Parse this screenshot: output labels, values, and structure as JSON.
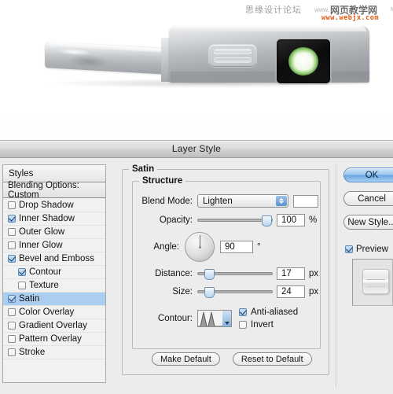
{
  "watermark": {
    "forum_cn": "思缘设计论坛",
    "www_prefix": "www.",
    "site_cn": "网页教学网",
    "tm": "M",
    "url": "www.webjx.com"
  },
  "photo": {
    "alt_name": "metallic-handheld-device-with-green-screen"
  },
  "dialog": {
    "title": "Layer Style",
    "styles_panel": {
      "header": "Styles",
      "blending_options": "Blending Options: Custom",
      "items": [
        {
          "label": "Drop Shadow",
          "checked": false,
          "indent": false,
          "selected": false
        },
        {
          "label": "Inner Shadow",
          "checked": true,
          "indent": false,
          "selected": false
        },
        {
          "label": "Outer Glow",
          "checked": false,
          "indent": false,
          "selected": false
        },
        {
          "label": "Inner Glow",
          "checked": false,
          "indent": false,
          "selected": false
        },
        {
          "label": "Bevel and Emboss",
          "checked": true,
          "indent": false,
          "selected": false
        },
        {
          "label": "Contour",
          "checked": true,
          "indent": true,
          "selected": false
        },
        {
          "label": "Texture",
          "checked": false,
          "indent": true,
          "selected": false
        },
        {
          "label": "Satin",
          "checked": true,
          "indent": false,
          "selected": true
        },
        {
          "label": "Color Overlay",
          "checked": false,
          "indent": false,
          "selected": false
        },
        {
          "label": "Gradient Overlay",
          "checked": false,
          "indent": false,
          "selected": false
        },
        {
          "label": "Pattern Overlay",
          "checked": false,
          "indent": false,
          "selected": false
        },
        {
          "label": "Stroke",
          "checked": false,
          "indent": false,
          "selected": false
        }
      ]
    },
    "satin": {
      "group_legend": "Satin",
      "structure_legend": "Structure",
      "blend_mode": {
        "label": "Blend Mode:",
        "value": "Lighten",
        "swatch_color": "#ffffff"
      },
      "opacity": {
        "label": "Opacity:",
        "value": "100",
        "unit": "%",
        "slider_pct": 96
      },
      "angle": {
        "label": "Angle:",
        "value": "90",
        "unit": "°"
      },
      "distance": {
        "label": "Distance:",
        "value": "17",
        "unit": "px",
        "slider_pct": 10
      },
      "size": {
        "label": "Size:",
        "value": "24",
        "unit": "px",
        "slider_pct": 10
      },
      "contour": {
        "label": "Contour:"
      },
      "anti_aliased": {
        "label": "Anti-aliased",
        "checked": true
      },
      "invert": {
        "label": "Invert",
        "checked": false
      },
      "make_default": "Make Default",
      "reset_to_default": "Reset to Default"
    },
    "buttons": {
      "ok": "OK",
      "cancel": "Cancel",
      "new_style": "New Style...",
      "preview": {
        "label": "Preview",
        "checked": true
      }
    }
  },
  "colors": {
    "selection_blue": "#aacdf0",
    "primary_button": "#6aa7e2",
    "dialog_bg": "#ececec",
    "screen_glow_green": "#7fc25c"
  }
}
